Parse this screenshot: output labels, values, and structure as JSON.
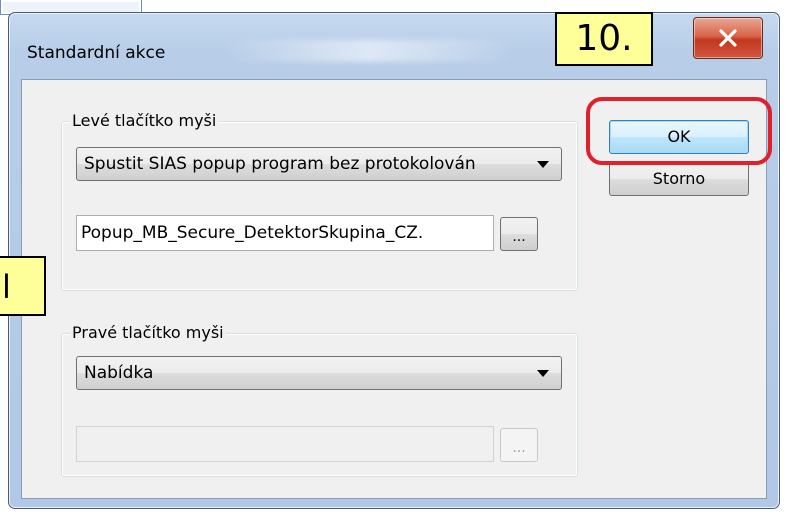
{
  "window": {
    "title": "Standardní akce",
    "close_icon": "close-icon"
  },
  "left_group": {
    "label": "Levé tlačítko myši",
    "action_select": "Spustit SIAS popup program bez protokolován",
    "program_field": "Popup_MB_Secure_DetektorSkupina_CZ.",
    "browse_label": "..."
  },
  "right_group": {
    "label": "Pravé tlačítko myši",
    "action_select": "Nabídka",
    "program_field": "",
    "browse_label": "..."
  },
  "buttons": {
    "ok": "OK",
    "cancel": "Storno"
  },
  "annotations": {
    "step_label": "10.",
    "left_label": "l",
    "highlight_color": "#e0202a",
    "callout_color": "#ffff99"
  }
}
